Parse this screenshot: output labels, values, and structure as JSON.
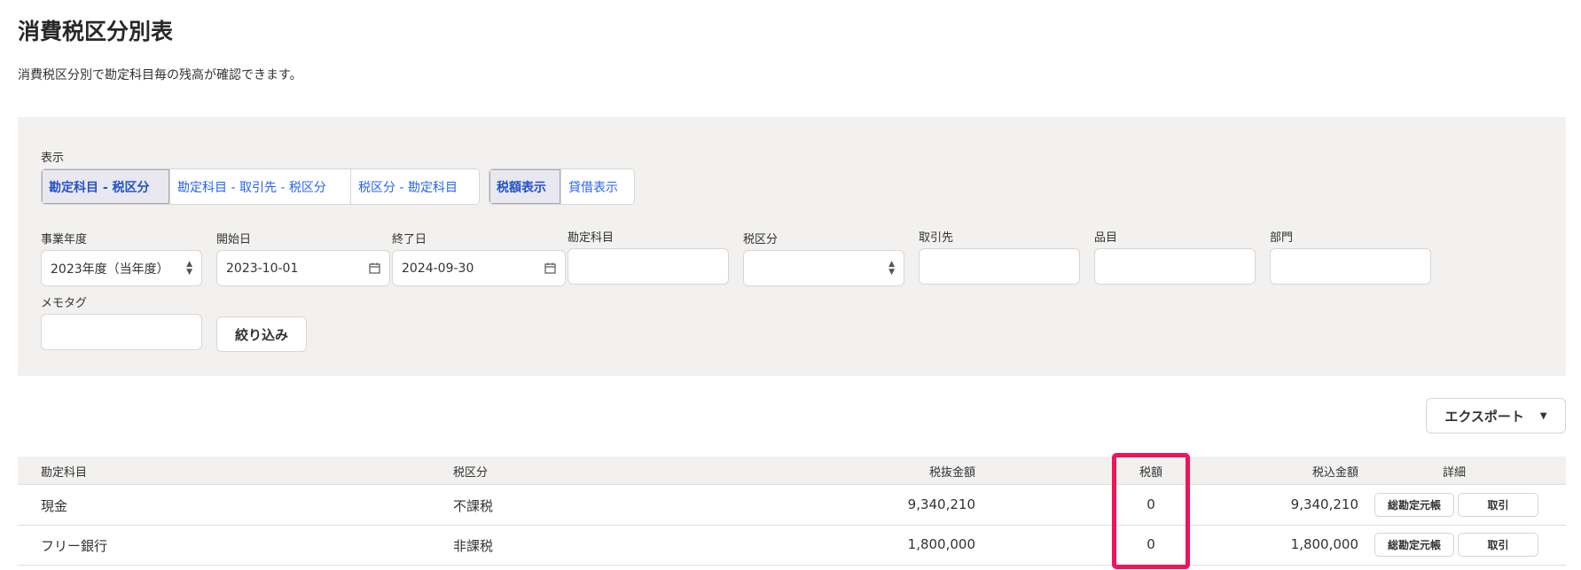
{
  "header": {
    "title": "消費税区分別表",
    "description": "消費税区分別で勘定科目毎の残高が確認できます。"
  },
  "filters": {
    "display_label": "表示",
    "view_options": [
      "勘定科目 - 税区分",
      "勘定科目 - 取引先 - 税区分",
      "税区分 - 勘定科目"
    ],
    "amount_options": [
      "税額表示",
      "貸借表示"
    ],
    "fiscal_year": {
      "label": "事業年度",
      "value": "2023年度（当年度）"
    },
    "start_date": {
      "label": "開始日",
      "value": "2023-10-01"
    },
    "end_date": {
      "label": "終了日",
      "value": "2024-09-30"
    },
    "account": {
      "label": "勘定科目",
      "value": ""
    },
    "tax_category": {
      "label": "税区分",
      "value": ""
    },
    "partner": {
      "label": "取引先",
      "value": ""
    },
    "item": {
      "label": "品目",
      "value": ""
    },
    "department": {
      "label": "部門",
      "value": ""
    },
    "memo_tag": {
      "label": "メモタグ",
      "value": ""
    },
    "apply_button": "絞り込み"
  },
  "export_button": "エクスポート",
  "table": {
    "headers": [
      "勘定科目",
      "税区分",
      "税抜金額",
      "税額",
      "税込金額",
      "詳細"
    ],
    "rows": [
      {
        "account": "現金",
        "tax_category": "不課税",
        "amount_excl": "9,340,210",
        "tax": "0",
        "amount_incl": "9,340,210",
        "ledger_button": "総勘定元帳",
        "transaction_button": "取引"
      },
      {
        "account": "フリー銀行",
        "tax_category": "非課税",
        "amount_excl": "1,800,000",
        "tax": "0",
        "amount_incl": "1,800,000",
        "ledger_button": "総勘定元帳",
        "transaction_button": "取引"
      }
    ]
  },
  "colors": {
    "accent_link": "#2864f0",
    "highlight": "#f0145a",
    "panel_bg": "#f2f1f0"
  }
}
